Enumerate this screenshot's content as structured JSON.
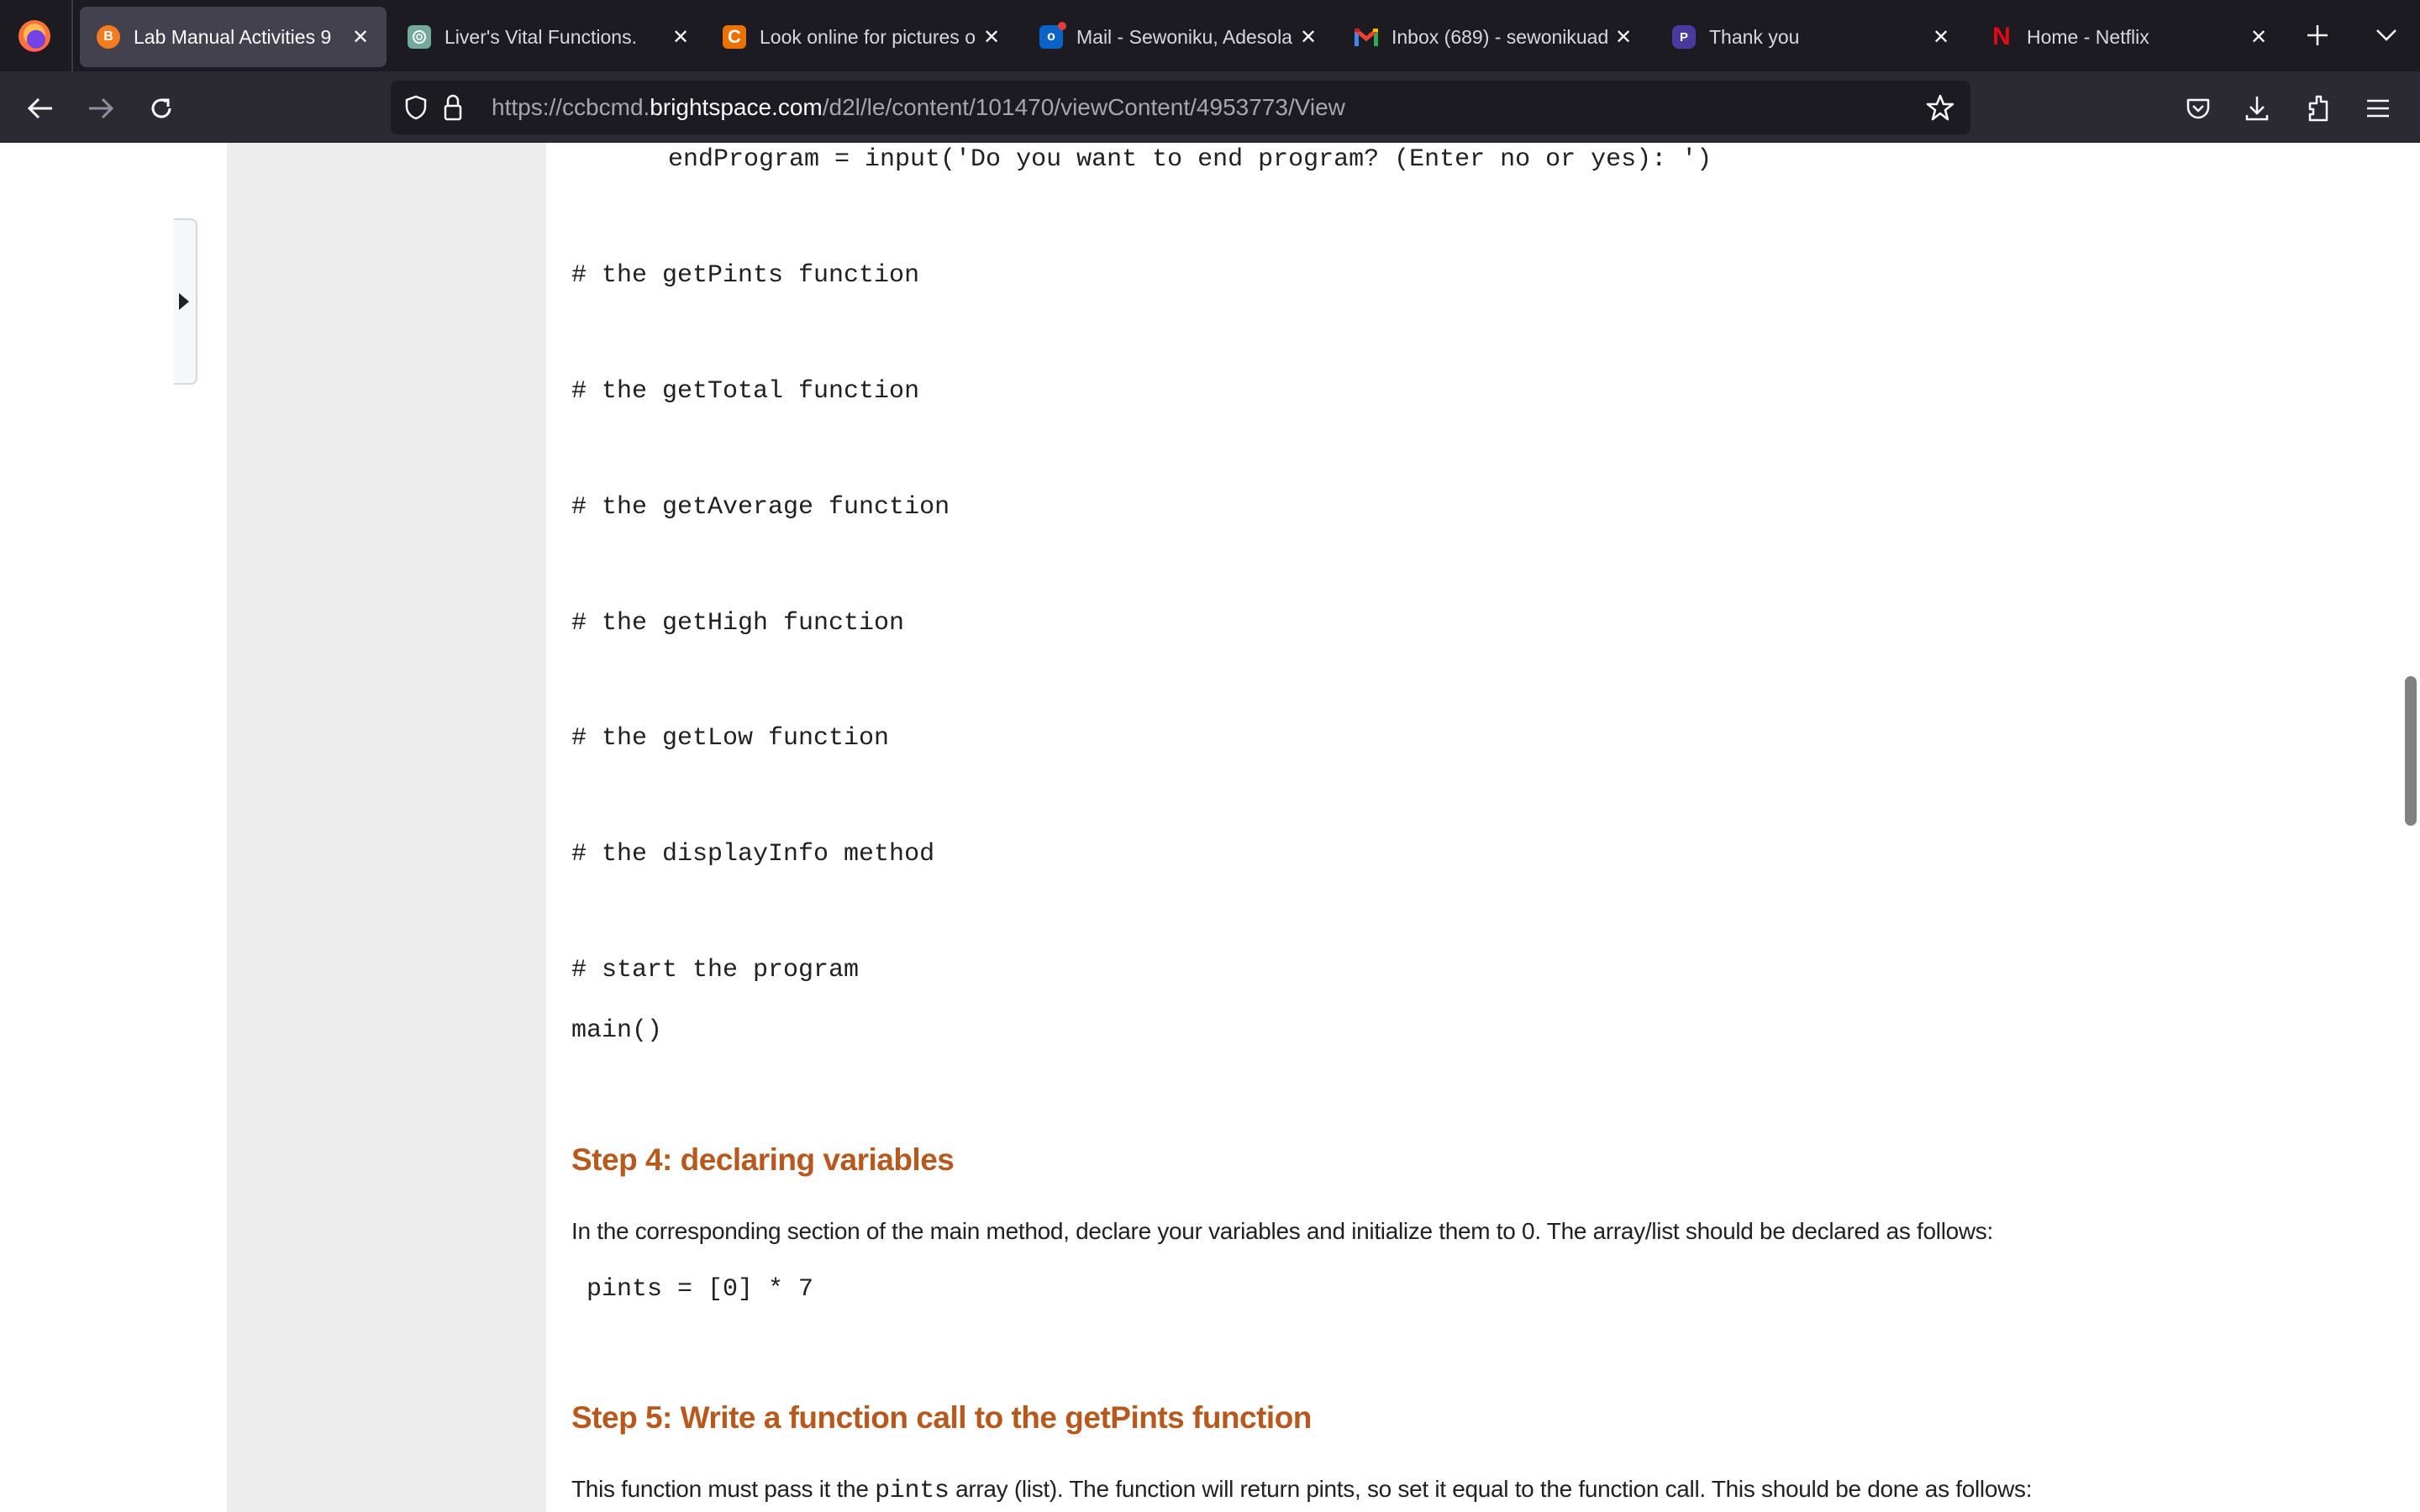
{
  "browser": {
    "tabs": [
      {
        "title": "Lab Manual Activities 9",
        "icon": "brightspace-icon",
        "icon_color": "#f47b20",
        "active": true
      },
      {
        "title": "Liver's Vital Functions.",
        "icon": "chatgpt-icon",
        "icon_color": "#74aa9c",
        "active": false
      },
      {
        "title": "Look online for pictures o",
        "icon": "chegg-icon",
        "icon_color": "#eb7100",
        "active": false
      },
      {
        "title": "Mail - Sewoniku, Adesola",
        "icon": "outlook-icon",
        "icon_color": "#0a64c8",
        "active": false
      },
      {
        "title": "Inbox (689) - sewonikuad",
        "icon": "gmail-icon",
        "icon_color": "#ea4335",
        "active": false
      },
      {
        "title": "Thank you",
        "icon": "p-app-icon",
        "icon_color": "#4a3aa0",
        "active": false
      },
      {
        "title": "Home - Netflix",
        "icon": "netflix-icon",
        "icon_color": "#e50914",
        "active": false
      }
    ],
    "new_tab_label": "+",
    "tab_list_label": "∨",
    "close_glyph": "✕",
    "url": {
      "prefix": "https://ccbcmd.",
      "domain": "brightspace.com",
      "path": "/d2l/le/content/101470/viewContent/4953773/View"
    }
  },
  "content": {
    "code_top": "endProgram = input('Do you want to end program? (Enter no or yes): ')",
    "code_comments": [
      "# the getPints function",
      "# the getTotal function",
      "# the getAverage function",
      "# the getHigh function",
      "# the getLow function",
      "# the displayInfo method",
      "# start the program"
    ],
    "main_call": "main()",
    "step4": {
      "heading": "Step 4:  declaring variables",
      "paragraph": "In the corresponding section of the main method, declare your variables and initialize them to 0.  The array/list should be declared as follows:",
      "code": "pints = [0] * 7"
    },
    "step5": {
      "heading": "Step 5:  Write a function call to the getPints function",
      "paragraph_before": "This function must pass it the ",
      "paragraph_code": "pints",
      "paragraph_after": " array (list).  The function will return pints, so set it equal to the function call.  This should be done as follows:"
    }
  },
  "colors": {
    "heading": "#b8581d",
    "tabbar_bg": "#1c1b22",
    "navbar_bg": "#2b2a33",
    "sidebar_bg": "#ededed"
  }
}
